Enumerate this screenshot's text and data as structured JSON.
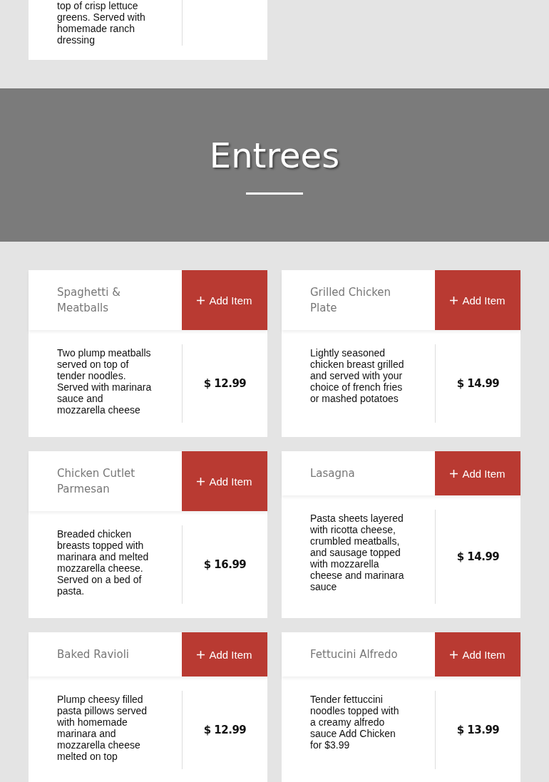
{
  "previous_item": {
    "description": "top of crisp lettuce greens. Served with homemade ranch dressing"
  },
  "section": {
    "title": "Entrees"
  },
  "items": [
    {
      "name": "Spaghetti & Meatballs",
      "button": "Add Item",
      "description": "Two plump meatballs served on top of tender noodles. Served with marinara sauce and mozzarella cheese",
      "price": "$ 12.99"
    },
    {
      "name": "Grilled Chicken Plate",
      "button": "Add Item",
      "description": "Lightly seasoned chicken breast grilled and served with your choice of french fries or mashed potatoes",
      "price": "$ 14.99"
    },
    {
      "name": "Chicken Cutlet Parmesan",
      "button": "Add Item",
      "description": "Breaded chicken breasts topped with marinara and melted mozzarella cheese. Served on a bed of pasta.",
      "price": "$ 16.99"
    },
    {
      "name": "Lasagna",
      "button": "Add Item",
      "description": "Pasta sheets layered with ricotta cheese, crumbled meatballs, and sausage topped with mozzarella cheese and marinara sauce",
      "price": "$ 14.99"
    },
    {
      "name": "Baked Ravioli",
      "button": "Add Item",
      "description": "Plump cheesy filled pasta pillows served with homemade marinara and mozzarella cheese melted on top",
      "price": "$ 12.99"
    },
    {
      "name": "Fettucini Alfredo",
      "button": "Add Item",
      "description": "Tender fettuccini noodles topped with a creamy alfredo sauce Add Chicken for $3.99",
      "price": "$ 13.99"
    }
  ]
}
